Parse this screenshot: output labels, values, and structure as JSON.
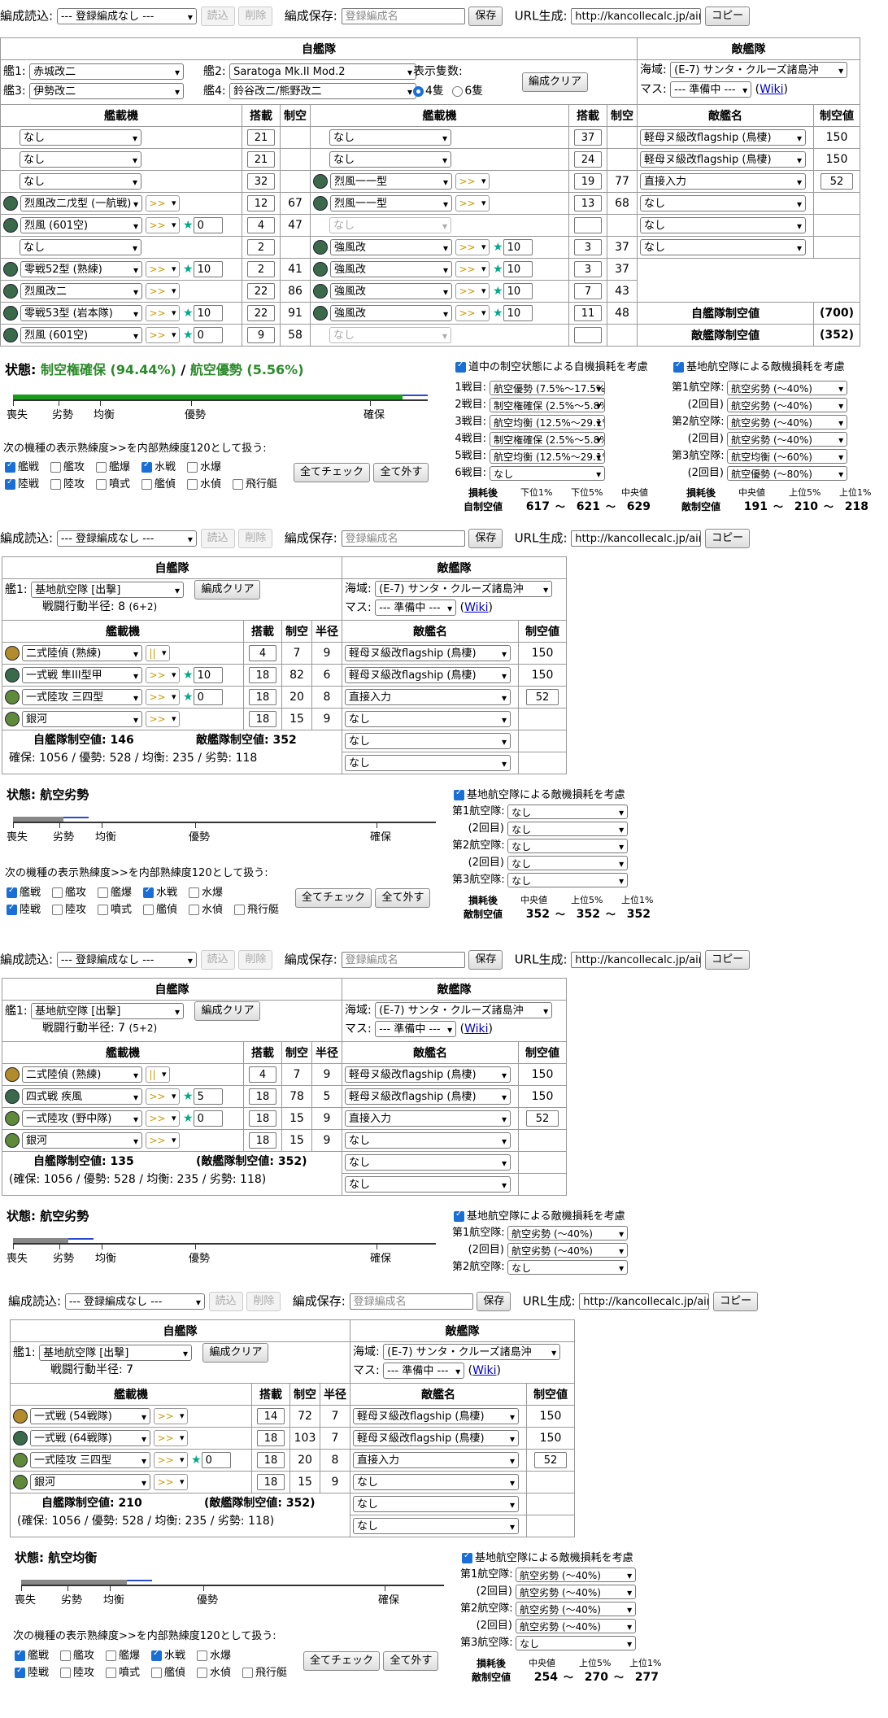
{
  "common": {
    "load_label": "編成読込:",
    "load_value": "--- 登録編成なし ---",
    "read_btn": "読込",
    "delete_btn": "削除",
    "save_label": "編成保存:",
    "save_placeholder": "登録編成名",
    "save_btn": "保存",
    "url_label": "URL生成:",
    "url_value": "http://kancollecalc.jp/air_",
    "copy_btn": "コピー",
    "own_fleet": "自艦隊",
    "enemy_fleet": "敵艦隊",
    "col_equip": "艦載機",
    "col_slots": "搭載",
    "col_air": "制空",
    "col_radius": "半径",
    "col_enemy": "敵艦名",
    "col_enemy_air": "制空値",
    "sea_label": "海域:",
    "sea_value": "(E-7) サンタ・クルーズ諸島沖",
    "cell_label": "マス:",
    "cell_value": "--- 準備中 ---",
    "wiki": "Wiki",
    "clear_btn": "編成クリア",
    "status_label": "状態:",
    "scale": [
      "喪失",
      "劣勢",
      "均衡",
      "優勢",
      "確保"
    ],
    "prof_note": "次の機種の表示熟練度>>を内部熟練度120として扱う:",
    "check_all": "全てチェック",
    "uncheck_all": "全て外す",
    "types_row1": [
      "艦戦",
      "艦攻",
      "艦爆",
      "水戦",
      "水爆"
    ],
    "types_row2": [
      "陸戦",
      "陸攻",
      "噴式",
      "艦偵",
      "水偵",
      "飛行艇"
    ],
    "after_loss": "損耗後",
    "enemy_air_label": "敵制空値",
    "own_air_label": "自制空値",
    "pct_low1": "下位1%",
    "pct_low5": "下位5%",
    "pct_mid": "中央値",
    "pct_up5": "上位5%",
    "pct_up1": "上位1%",
    "tilde": "～",
    "enemy_rows": [
      {
        "name": "軽母ヌ級改flagship (鳥棲)",
        "val": "150"
      },
      {
        "name": "軽母ヌ級改flagship (鳥棲)",
        "val": "150"
      },
      {
        "name": "直接入力",
        "val": "52"
      },
      {
        "name": "なし",
        "val": ""
      },
      {
        "name": "なし",
        "val": ""
      },
      {
        "name": "なし",
        "val": ""
      }
    ],
    "base_loss_label": "基地航空隊による敵機損耗を考慮"
  },
  "s1": {
    "ship1_label": "艦1:",
    "ship1": "赤城改二",
    "ship2_label": "艦2:",
    "ship2": "Saratoga Mk.II Mod.2",
    "ship3_label": "艦3:",
    "ship3": "伊勢改二",
    "ship4_label": "艦4:",
    "ship4": "鈴谷改二/熊野改二",
    "count_label": "表示隻数:",
    "count4": "4隻",
    "count6": "6隻",
    "left_rows": [
      {
        "eq": "なし",
        "slot": "21",
        "air": ""
      },
      {
        "eq": "なし",
        "slot": "21",
        "air": ""
      },
      {
        "eq": "なし",
        "slot": "32",
        "air": ""
      },
      {
        "eq": "烈風改二戊型 (一航戦)",
        "slot": "12",
        "air": "67",
        "icon": true,
        "prof": ">>"
      },
      {
        "eq": "烈風 (601空)",
        "slot": "4",
        "air": "47",
        "icon": true,
        "prof": ">>",
        "star": "0"
      },
      {
        "eq": "なし",
        "slot": "2",
        "air": ""
      },
      {
        "eq": "零戦52型 (熟練)",
        "slot": "2",
        "air": "41",
        "icon": true,
        "prof": ">>",
        "star": "10"
      },
      {
        "eq": "烈風改二",
        "slot": "22",
        "air": "86",
        "icon": true,
        "prof": ">>"
      },
      {
        "eq": "零戦53型 (岩本隊)",
        "slot": "22",
        "air": "91",
        "icon": true,
        "prof": ">>",
        "star": "10"
      },
      {
        "eq": "烈風 (601空)",
        "slot": "9",
        "air": "58",
        "icon": true,
        "prof": ">>",
        "star": "0"
      }
    ],
    "right_rows": [
      {
        "eq": "なし",
        "slot": "37",
        "air": ""
      },
      {
        "eq": "なし",
        "slot": "24",
        "air": ""
      },
      {
        "eq": "烈風一一型",
        "slot": "19",
        "air": "77",
        "icon": true,
        "prof": ">>"
      },
      {
        "eq": "烈風一一型",
        "slot": "13",
        "air": "68",
        "icon": true,
        "prof": ">>"
      },
      {
        "eq": "なし",
        "slot": "",
        "air": "",
        "dis": true
      },
      {
        "eq": "強風改",
        "slot": "3",
        "air": "37",
        "icon": true,
        "prof": ">>",
        "star": "10"
      },
      {
        "eq": "強風改",
        "slot": "3",
        "air": "37",
        "icon": true,
        "prof": ">>",
        "star": "10"
      },
      {
        "eq": "強風改",
        "slot": "7",
        "air": "43",
        "icon": true,
        "prof": ">>",
        "star": "10"
      },
      {
        "eq": "強風改",
        "slot": "11",
        "air": "48",
        "icon": true,
        "prof": ">>",
        "star": "10"
      },
      {
        "eq": "なし",
        "slot": "",
        "air": "",
        "dis": true
      }
    ],
    "own_air_label": "自艦隊制空値",
    "own_air_val": "(700)",
    "enemy_air_label": "敵艦隊制空値",
    "enemy_air_val": "(352)",
    "status_a": "制空権確保 (94.44%)",
    "status_sep": " / ",
    "status_b": "航空優勢 (5.56%)",
    "bar_fill_pct": 0.94,
    "route_check": "道中の制空状態による自機損耗を考慮",
    "route_rows": [
      {
        "label": "1戦目:",
        "val": "航空優勢 (7.5%〜17.5%)"
      },
      {
        "label": "2戦目:",
        "val": "制空権確保 (2.5%〜5.8%)"
      },
      {
        "label": "3戦目:",
        "val": "航空均衡 (12.5%〜29.1%)"
      },
      {
        "label": "4戦目:",
        "val": "制空権確保 (2.5%〜5.8%)"
      },
      {
        "label": "5戦目:",
        "val": "航空均衡 (12.5%〜29.1%)"
      },
      {
        "label": "6戦目:",
        "val": "なし"
      }
    ],
    "base_rows": [
      {
        "label": "第1航空隊:",
        "val": "航空劣勢 (〜40%)"
      },
      {
        "label": "(2回目)",
        "val": "航空劣勢 (〜40%)"
      },
      {
        "label": "第2航空隊:",
        "val": "航空劣勢 (〜40%)"
      },
      {
        "label": "(2回目)",
        "val": "航空劣勢 (〜40%)"
      },
      {
        "label": "第3航空隊:",
        "val": "航空均衡 (〜60%)"
      },
      {
        "label": "(2回目)",
        "val": "航空優勢 (〜80%)"
      }
    ],
    "own_range": [
      "617",
      "621",
      "629"
    ],
    "enemy_range": [
      "191",
      "210",
      "218"
    ]
  },
  "bases": [
    {
      "ship1": "基地航空隊 [出撃]",
      "radius_label": "戦闘行動半径: 8",
      "radius_extra": "(6+2)",
      "rows": [
        {
          "eq": "二式陸偵 (熟練)",
          "slot": "4",
          "air": "7",
          "rad": "9",
          "prof": "||"
        },
        {
          "eq": "一式戦 隼III型甲",
          "slot": "18",
          "air": "82",
          "rad": "6",
          "prof": ">>",
          "star": "10"
        },
        {
          "eq": "一式陸攻 三四型",
          "slot": "18",
          "air": "20",
          "rad": "8",
          "prof": ">>",
          "star": "0"
        },
        {
          "eq": "銀河",
          "slot": "18",
          "air": "15",
          "rad": "9",
          "prof": ">>"
        }
      ],
      "sum1": "自艦隊制空値: 146",
      "sum2": "敵艦隊制空値: 352",
      "sum3": "確保: 1056 / 優勢: 528 / 均衡: 235 / 劣勢: 118",
      "status": "航空劣勢",
      "fill": 0.12,
      "base_rows": [
        {
          "label": "第1航空隊:",
          "val": "なし"
        },
        {
          "label": "(2回目)",
          "val": "なし"
        },
        {
          "label": "第2航空隊:",
          "val": "なし"
        },
        {
          "label": "(2回目)",
          "val": "なし"
        },
        {
          "label": "第3航空隊:",
          "val": "なし"
        }
      ],
      "range": [
        "352",
        "352",
        "352"
      ]
    },
    {
      "ship1": "基地航空隊 [出撃]",
      "radius_label": "戦闘行動半径: 7",
      "radius_extra": "(5+2)",
      "rows": [
        {
          "eq": "二式陸偵 (熟練)",
          "slot": "4",
          "air": "7",
          "rad": "9",
          "prof": "||"
        },
        {
          "eq": "四式戦 疾風",
          "slot": "18",
          "air": "78",
          "rad": "5",
          "prof": ">>",
          "star": "5"
        },
        {
          "eq": "一式陸攻 (野中隊)",
          "slot": "18",
          "air": "15",
          "rad": "9",
          "prof": ">>",
          "star": "0"
        },
        {
          "eq": "銀河",
          "slot": "18",
          "air": "15",
          "rad": "9",
          "prof": ">>"
        }
      ],
      "sum1": "自艦隊制空値: 135",
      "sum2": "(敵艦隊制空値: 352)",
      "sum3": "(確保: 1056 / 優勢: 528 / 均衡: 235 / 劣勢: 118)",
      "status": "航空劣勢",
      "fill": 0.13,
      "base_rows": [
        {
          "label": "第1航空隊:",
          "val": "航空劣勢 (〜40%)"
        },
        {
          "label": "(2回目)",
          "val": "航空劣勢 (〜40%)"
        },
        {
          "label": "第2航空隊:",
          "val": "なし"
        }
      ]
    },
    {
      "ship1": "基地航空隊 [出撃]",
      "radius_label": "戦闘行動半径: 7",
      "radius_extra": "",
      "rows": [
        {
          "eq": "一式戦 (54戦隊)",
          "slot": "14",
          "air": "72",
          "rad": "7",
          "prof": ">>"
        },
        {
          "eq": "一式戦 (64戦隊)",
          "slot": "18",
          "air": "103",
          "rad": "7",
          "prof": ">>"
        },
        {
          "eq": "一式陸攻 三四型",
          "slot": "18",
          "air": "20",
          "rad": "8",
          "prof": ">>",
          "star": "0"
        },
        {
          "eq": "銀河",
          "slot": "18",
          "air": "15",
          "rad": "9",
          "prof": ">>"
        }
      ],
      "sum1": "自艦隊制空値: 210",
      "sum2": "(敵艦隊制空値: 352)",
      "sum3": "(確保: 1056 / 優勢: 528 / 均衡: 235 / 劣勢: 118)",
      "status": "航空均衡",
      "fill": 0.25,
      "base_rows": [
        {
          "label": "第1航空隊:",
          "val": "航空劣勢 (〜40%)"
        },
        {
          "label": "(2回目)",
          "val": "航空劣勢 (〜40%)"
        },
        {
          "label": "第2航空隊:",
          "val": "航空劣勢 (〜40%)"
        },
        {
          "label": "(2回目)",
          "val": "航空劣勢 (〜40%)"
        },
        {
          "label": "第3航空隊:",
          "val": "なし"
        }
      ],
      "range": [
        "254",
        "270",
        "277"
      ]
    }
  ],
  "colors": {
    "green": "#1a9a1a",
    "status_green": "#2a8a2a",
    "gray": "#888888",
    "blue": "#2a4ad0"
  }
}
